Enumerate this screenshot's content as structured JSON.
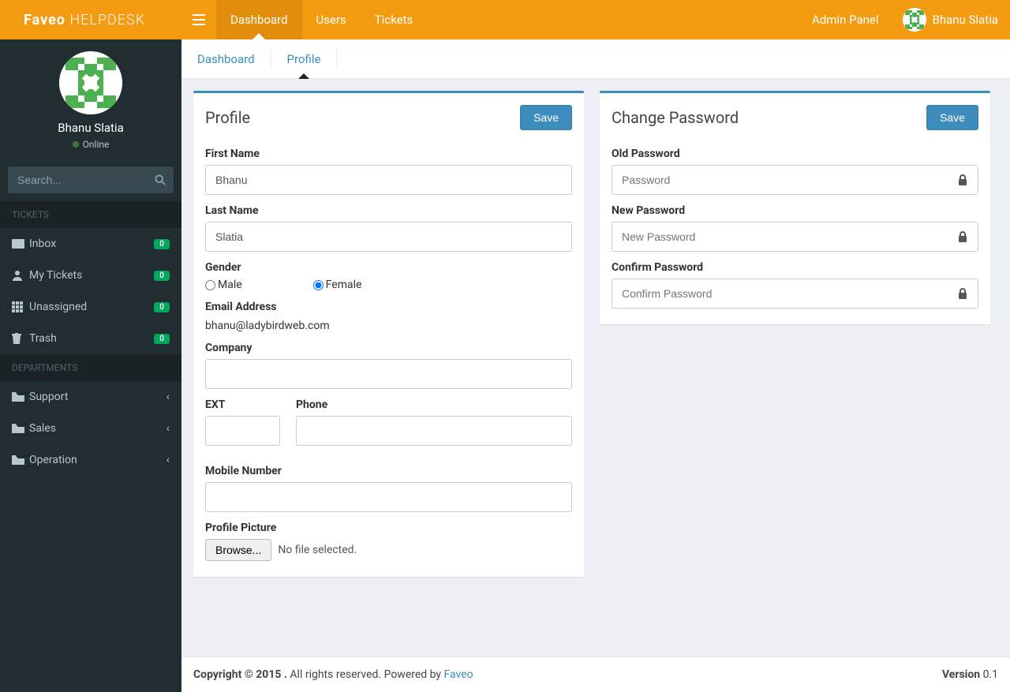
{
  "brand": {
    "part1": "Faveo",
    "part2": "HELPDESK"
  },
  "topnav": {
    "dashboard": "Dashboard",
    "users": "Users",
    "tickets": "Tickets"
  },
  "top_right": {
    "admin_panel": "Admin Panel",
    "username": "Bhanu Slatia"
  },
  "sidebar": {
    "user": {
      "name": "Bhanu Slatia",
      "status": "Online"
    },
    "search_placeholder": "Search...",
    "headers": {
      "tickets": "TICKETS",
      "departments": "DEPARTMENTS"
    },
    "tickets": [
      {
        "label": "Inbox",
        "badge": "0"
      },
      {
        "label": "My Tickets",
        "badge": "0"
      },
      {
        "label": "Unassigned",
        "badge": "0"
      },
      {
        "label": "Trash",
        "badge": "0"
      }
    ],
    "departments": [
      {
        "label": "Support"
      },
      {
        "label": "Sales"
      },
      {
        "label": "Operation"
      }
    ]
  },
  "subnav": {
    "dashboard": "Dashboard",
    "profile": "Profile"
  },
  "profile_box": {
    "title": "Profile",
    "save": "Save",
    "labels": {
      "first_name": "First Name",
      "last_name": "Last Name",
      "gender": "Gender",
      "male": "Male",
      "female": "Female",
      "email": "Email Address",
      "company": "Company",
      "ext": "EXT",
      "phone": "Phone",
      "mobile": "Mobile Number",
      "picture": "Profile Picture",
      "browse": "Browse...",
      "no_file": "No file selected."
    },
    "values": {
      "first_name": "Bhanu",
      "last_name": "Slatia",
      "email": "bhanu@ladybirdweb.com",
      "company": "",
      "ext": "",
      "phone": "",
      "mobile": ""
    }
  },
  "password_box": {
    "title": "Change Password",
    "save": "Save",
    "labels": {
      "old": "Old Password",
      "new": "New Password",
      "confirm": "Confirm Password"
    },
    "placeholders": {
      "old": "Password",
      "new": "New Password",
      "confirm": "Confirm Password"
    }
  },
  "footer": {
    "copyright": "Copyright © 2015 .",
    "rights": " All rights reserved. Powered by ",
    "link": "Faveo",
    "version_label": "Version",
    "version": " 0.1"
  }
}
